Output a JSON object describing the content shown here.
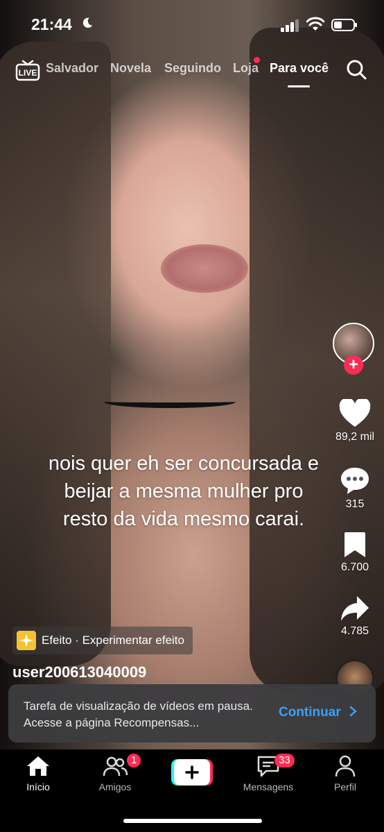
{
  "status": {
    "time": "21:44"
  },
  "top_nav": {
    "live_label": "LIVE",
    "tabs": [
      {
        "label": "Salvador"
      },
      {
        "label": "Novela"
      },
      {
        "label": "Seguindo"
      },
      {
        "label": "Loja"
      },
      {
        "label": "Para você"
      }
    ],
    "active_tab": "Para você"
  },
  "caption": "nois quer eh ser concursada e beijar a mesma mulher pro resto da vida mesmo carai.",
  "actions": {
    "likes": "89,2 mil",
    "comments": "315",
    "saves": "6.700",
    "shares": "4.785",
    "follow_symbol": "+"
  },
  "effect": {
    "text": "Efeito · Experimentar efeito"
  },
  "username": "user200613040009",
  "toast": {
    "message": "Tarefa de visualização de vídeos em pausa. Acesse a página Recompensas...",
    "button": "Continuar"
  },
  "bottom_nav": {
    "items": [
      {
        "label": "Início"
      },
      {
        "label": "Amigos",
        "badge": "1"
      },
      {
        "label": "+"
      },
      {
        "label": "Mensagens",
        "badge": "33"
      },
      {
        "label": "Perfil"
      }
    ]
  },
  "colors": {
    "accent": "#fe2c55",
    "link": "#3aa0ff",
    "cyan": "#25f4ee"
  }
}
